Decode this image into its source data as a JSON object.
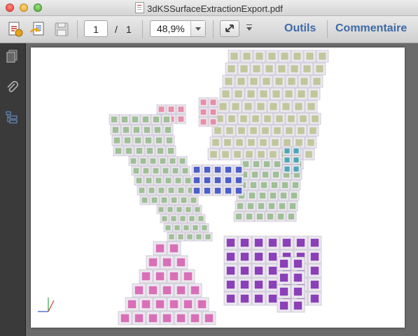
{
  "window": {
    "title": "3dKSSurfaceExtractionExport.pdf"
  },
  "toolbar": {
    "page_current": "1",
    "page_separator": "/",
    "page_total": "1",
    "zoom": "48,9%",
    "tools_label": "Outils",
    "comment_label": "Commentaire",
    "icons": [
      "create-pdf-icon",
      "share-pdf-icon",
      "save-icon",
      "expand-icon",
      "more-arrow-icon"
    ]
  },
  "sidebar": {
    "icons": [
      "page-thumbnails-icon",
      "attachments-icon",
      "layers-icon"
    ]
  },
  "figure": {
    "colors": {
      "olive": "#c2c79b",
      "green": "#9fbf95",
      "blue": "#4b5ec9",
      "teal": "#4aa7b5",
      "pink": "#e88fa8",
      "purple": "#8b3fb8",
      "magenta": "#d96fb7"
    }
  }
}
